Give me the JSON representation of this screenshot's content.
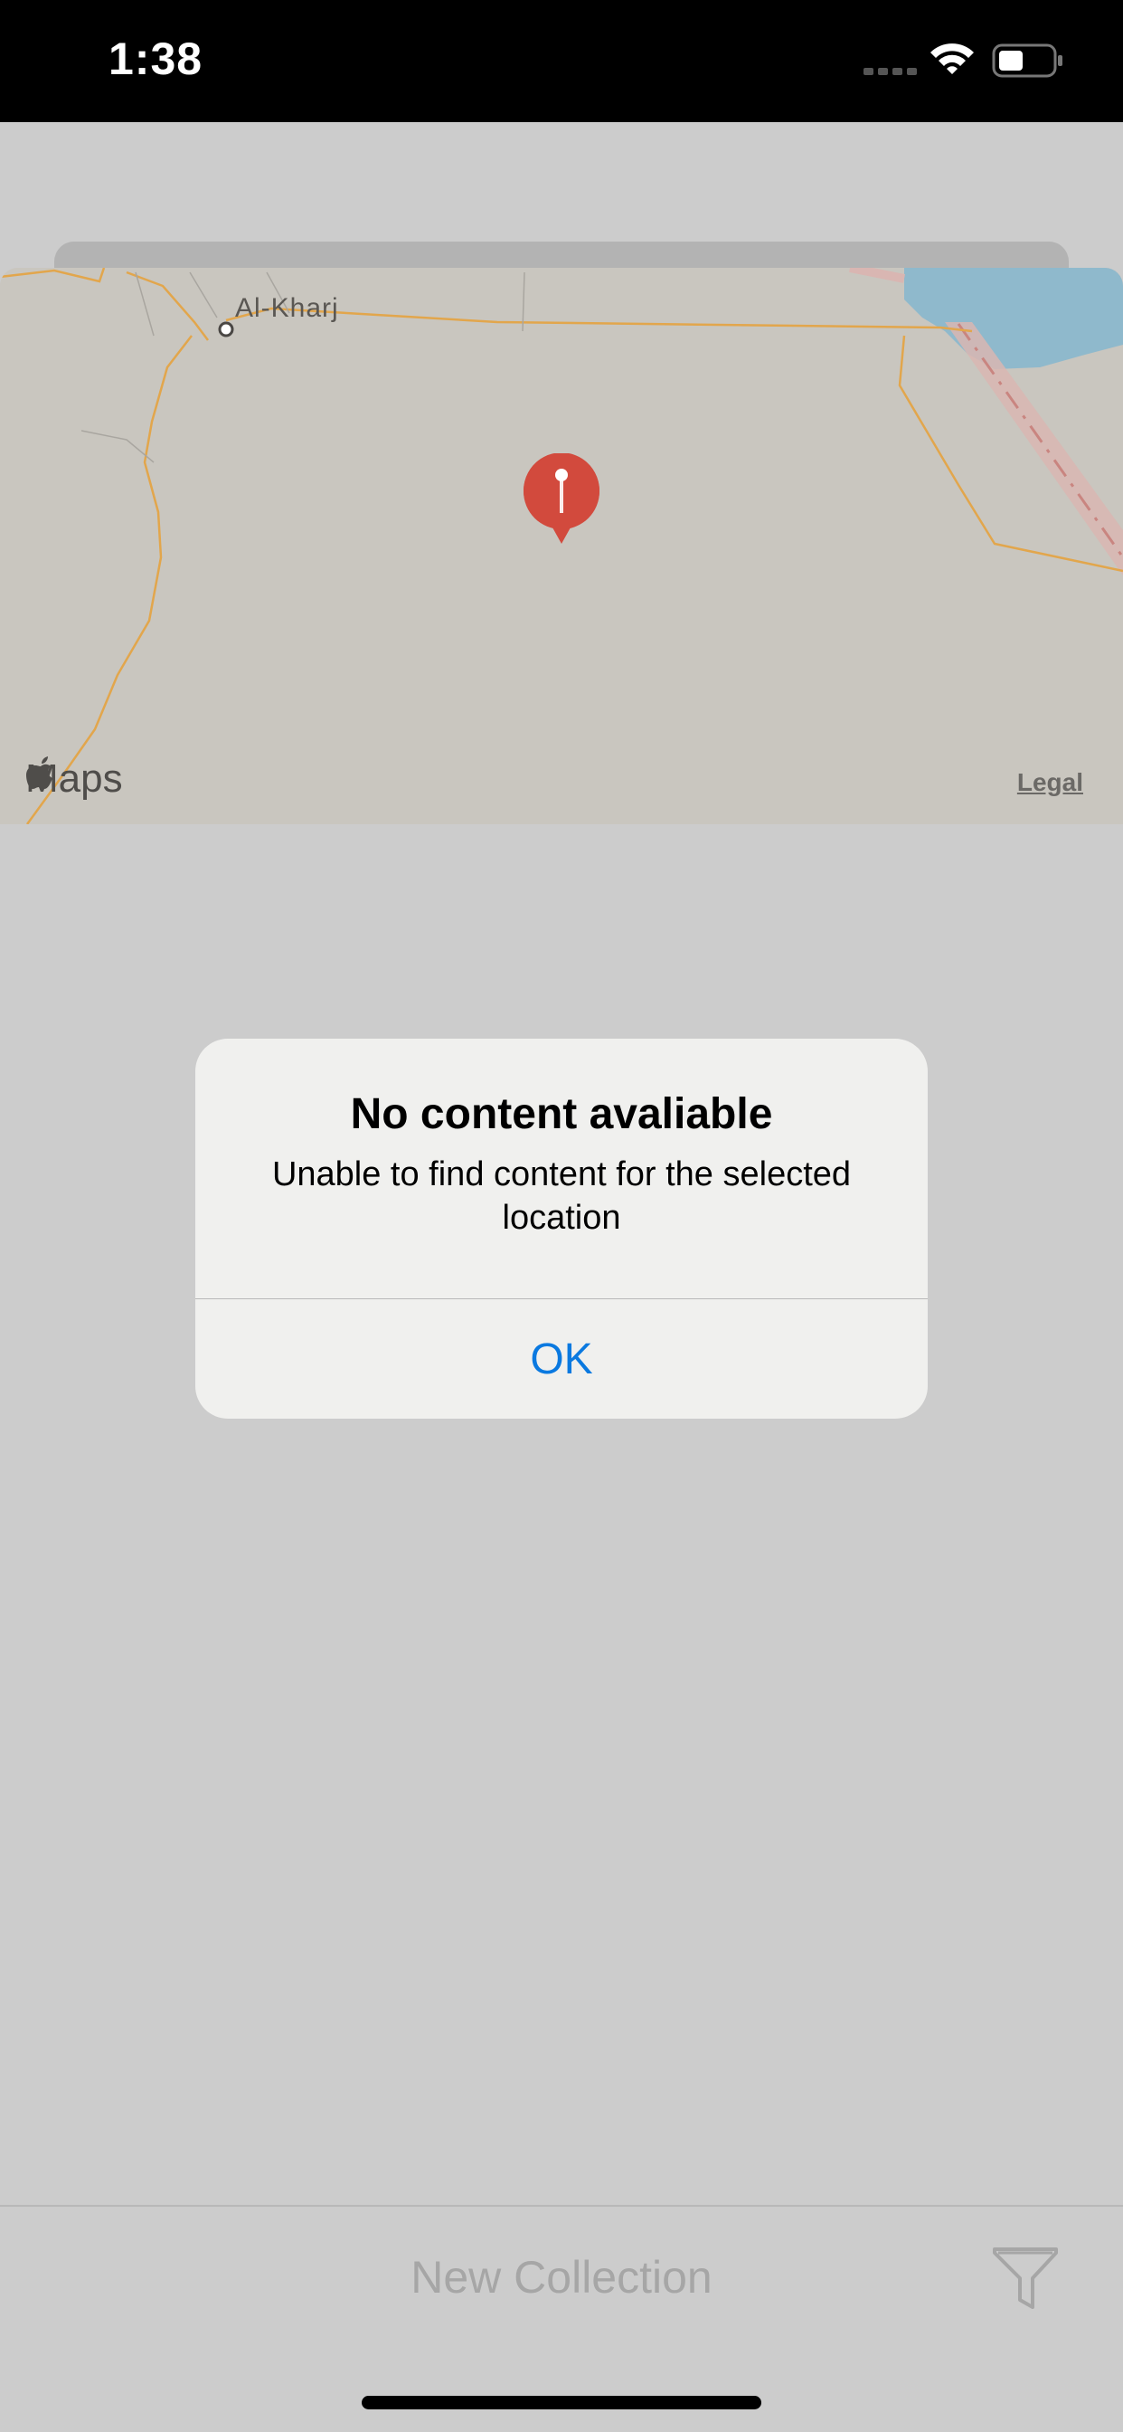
{
  "status_bar": {
    "time": "1:38"
  },
  "map": {
    "city_label": "Al-Kharj",
    "attribution": "Maps",
    "legal": "Legal",
    "icons": [
      "apple-logo-icon",
      "map-pin-icon"
    ]
  },
  "alert": {
    "title": "No content avaliable",
    "message": "Unable to find content for the selected location",
    "ok_label": "OK"
  },
  "toolbar": {
    "new_collection_label": "New Collection",
    "filter_icon": "filter-funnel-icon"
  },
  "colors": {
    "alert_action": "#0a79e0",
    "pin": "#d24a3d",
    "water": "#8fb9cc"
  }
}
